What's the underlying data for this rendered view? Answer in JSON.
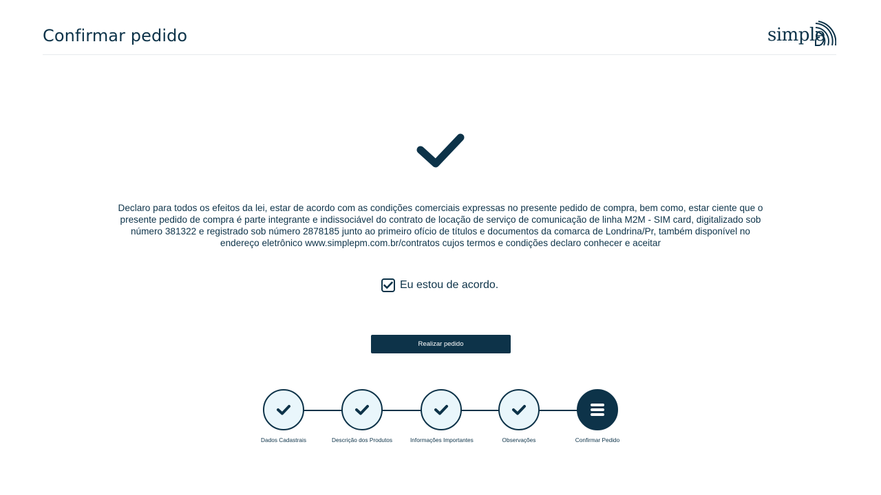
{
  "header": {
    "title": "Confirmar pedido",
    "logo_text": "simple"
  },
  "main": {
    "declaration": "Declaro para todos os efeitos da lei, estar de acordo com as condições comerciais expressas no presente pedido de compra, bem como, estar ciente que o presente pedido de compra é parte integrante e indissociável do contrato de locação de serviço de comunicação de linha M2M - SIM card, digitalizado sob número 381322 e registrado sob número 2878185 junto ao primeiro ofício de títulos e documentos da comarca de Londrina/Pr, também disponível no endereço eletrônico www.simplepm.com.br/contratos cujos termos e condições declaro conhecer e aceitar",
    "agree_label": "Eu estou de acordo.",
    "agree_checked": true,
    "submit_label": "Realizar pedido"
  },
  "stepper": {
    "steps": [
      {
        "label": "Dados Cadastrais",
        "status": "done",
        "icon": "check-icon"
      },
      {
        "label": "Descrição dos Produtos",
        "status": "done",
        "icon": "check-icon"
      },
      {
        "label": "Informações Importantes",
        "status": "done",
        "icon": "check-icon"
      },
      {
        "label": "Observações",
        "status": "done",
        "icon": "check-icon"
      },
      {
        "label": "Confirmar Pedido",
        "status": "current",
        "icon": "list-icon"
      }
    ]
  },
  "colors": {
    "primary": "#0d3349",
    "step_done_fill": "#e9f6fb",
    "divider": "#e6eaed"
  }
}
